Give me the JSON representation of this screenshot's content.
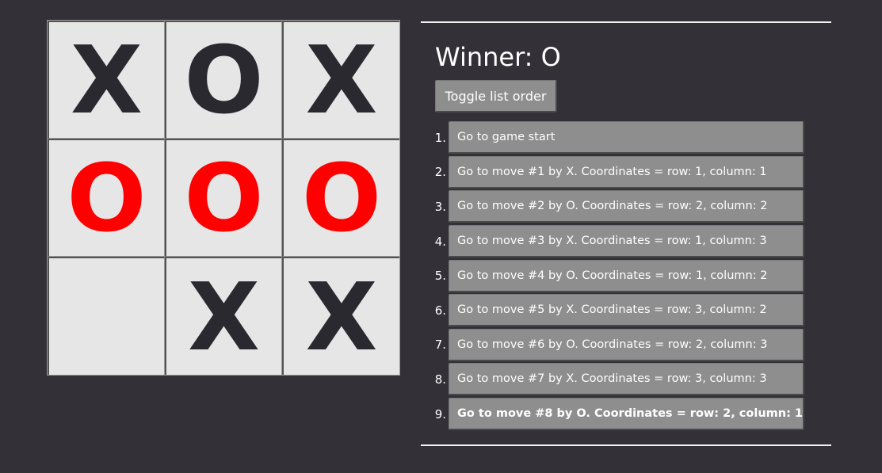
{
  "board": {
    "squares": [
      "X",
      "O",
      "X",
      "O",
      "O",
      "O",
      "",
      "X",
      "X"
    ],
    "winning_line": [
      3,
      4,
      5
    ],
    "colors": {
      "mark": "#2b2930",
      "winning_mark": "#ff0000",
      "square_bg": "#e6e6e6",
      "grid_line": "#9a9a9a"
    }
  },
  "info": {
    "status": "Winner: O",
    "toggle_label": "Toggle list order",
    "moves": [
      {
        "number": "1.",
        "label": "Go to game start"
      },
      {
        "number": "2.",
        "label": "Go to move #1 by X. Coordinates = row: 1, column: 1"
      },
      {
        "number": "3.",
        "label": "Go to move #2 by O. Coordinates = row: 2, column: 2"
      },
      {
        "number": "4.",
        "label": "Go to move #3 by X. Coordinates = row: 1, column: 3"
      },
      {
        "number": "5.",
        "label": "Go to move #4 by O. Coordinates = row: 1, column: 2"
      },
      {
        "number": "6.",
        "label": "Go to move #5 by X. Coordinates = row: 3, column: 2"
      },
      {
        "number": "7.",
        "label": "Go to move #6 by O. Coordinates = row: 2, column: 3"
      },
      {
        "number": "8.",
        "label": "Go to move #7 by X. Coordinates = row: 3, column: 3"
      },
      {
        "number": "9.",
        "label": "Go to move #8 by O. Coordinates = row: 2, column: 1"
      }
    ],
    "current_move_index": 8
  },
  "theme": {
    "background": "#333038",
    "button_bg": "#8e8e8e",
    "text": "#ffffff"
  }
}
